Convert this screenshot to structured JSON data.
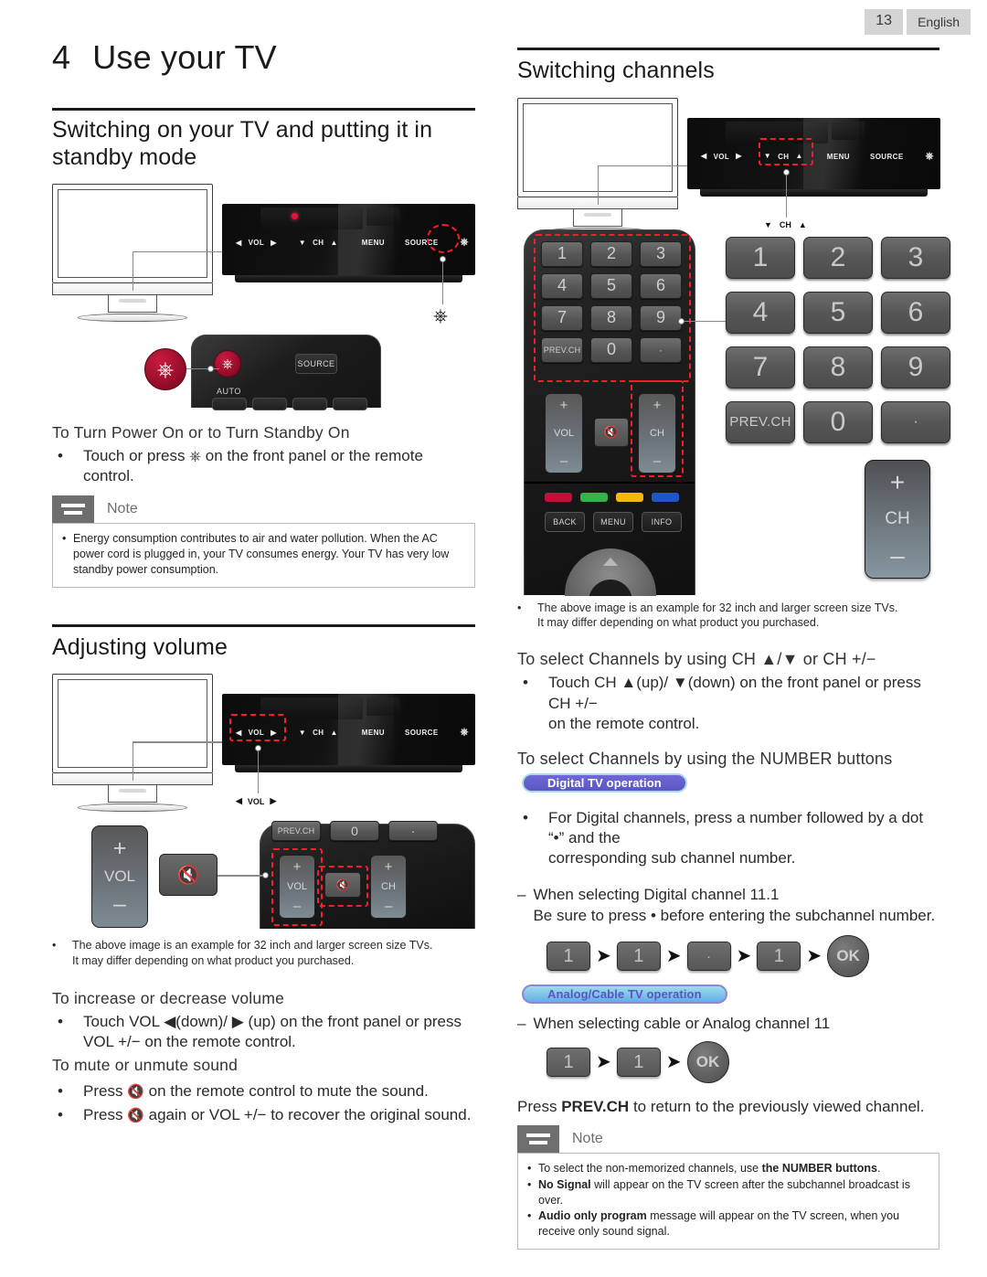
{
  "header": {
    "page_number": "13",
    "language": "English"
  },
  "chapter": {
    "number": "4",
    "title": "Use your TV"
  },
  "left": {
    "section_title": "Switching on your TV and putting it in standby mode",
    "panel_labels": {
      "vol": "VOL",
      "ch": "CH",
      "menu": "MENU",
      "source": "SOURCE"
    },
    "remote_closeup": {
      "source": "SOURCE",
      "auto": "AUTO"
    },
    "sub_power": "To Turn Power On or to Turn Standby On",
    "bullet_power_a": "Touch or press",
    "bullet_power_b": "on the front panel or the remote control.",
    "note_label": "Note",
    "note_text": "Energy consumption contributes to air and water pollution. When the AC power cord is plugged in, your TV consumes energy. Your TV has very low standby power consumption.",
    "section_volume": "Adjusting volume",
    "vol_callout": "VOL",
    "remote_keys": {
      "vol": "VOL",
      "ch": "CH",
      "prevch": "PREV.CH",
      "plus": "+",
      "minus": "−"
    },
    "example_note_line1": "The above image is an example for 32 inch and larger screen size TVs.",
    "example_note_line2": "It may differ depending on what product you purchased.",
    "sub_increase": "To increase or decrease volume",
    "bullet_increase_a": "Touch VOL",
    "bullet_increase_b": "(down)/",
    "bullet_increase_c": "(up) on the front panel or press",
    "bullet_increase_d": "VOL +/− on the remote control.",
    "sub_mute": "To mute or unmute sound",
    "bullet_mute_1_a": "Press",
    "bullet_mute_1_b": "on the remote control to mute the sound.",
    "bullet_mute_2_a": "Press",
    "bullet_mute_2_b": "again or VOL +/− to recover the original sound."
  },
  "right": {
    "section_title": "Switching channels",
    "panel_labels": {
      "vol": "VOL",
      "ch": "CH",
      "menu": "MENU",
      "source": "SOURCE"
    },
    "ch_callout": "CH",
    "keypad": [
      "1",
      "2",
      "3",
      "4",
      "5",
      "6",
      "7",
      "8",
      "9"
    ],
    "keypad_bottom": [
      "PREV.CH",
      "0",
      "·"
    ],
    "remote_keys": {
      "vol": "VOL",
      "ch": "CH",
      "mute": "mute",
      "plus": "+",
      "minus": "−"
    },
    "function_keys": [
      "BACK",
      "MENU",
      "INFO"
    ],
    "color_keys": [
      "red",
      "green",
      "yellow",
      "blue"
    ],
    "example_note_line1": "The above image is an example for 32 inch and larger screen size TVs.",
    "example_note_line2": "It may differ depending on what product you purchased.",
    "sub_ch_select_a": "To select Channels by using CH",
    "sub_ch_select_b": "or CH +/−",
    "bullet_ch_a": "Touch CH",
    "bullet_ch_b": "(up)/",
    "bullet_ch_c": "(down) on the front panel or press CH +/−",
    "bullet_ch_d": "on the remote control.",
    "sub_number_select": "To select Channels by using the NUMBER buttons",
    "badge_digital": "Digital TV operation",
    "bullet_digital_a": "For Digital channels, press a number followed by a dot “•” and the",
    "bullet_digital_b": "corresponding sub channel number.",
    "dash_digital_a": "When selecting Digital channel 11.1",
    "dash_digital_b": "Be sure to press • before entering the subchannel number.",
    "seq_digital": [
      "1",
      "1",
      "·",
      "1"
    ],
    "seq_ok": "OK",
    "badge_analog": "Analog/Cable TV operation",
    "dash_analog": "When selecting cable or Analog channel 11",
    "seq_analog": [
      "1",
      "1"
    ],
    "prevch_text_a": "Press",
    "prevch_text_b": "PREV.CH",
    "prevch_text_c": "to return to the previously viewed channel.",
    "note_label": "Note",
    "note_1_a": "To select the non-memorized channels, use",
    "note_1_b": "the NUMBER buttons",
    "note_1_c": ".",
    "note_2_a": "No Signal",
    "note_2_b": "will appear on the TV screen after the subchannel broadcast is over.",
    "note_3_a": "Audio only program",
    "note_3_b": "message will appear on the TV screen, when you receive only sound signal."
  },
  "colors": {
    "highlight": "#f31d2b",
    "power_red": "#b01030",
    "badge_digital_bg": "#5a57c4",
    "badge_analog_bg": "#62aee6",
    "note_tab": "#6e6e6e"
  }
}
